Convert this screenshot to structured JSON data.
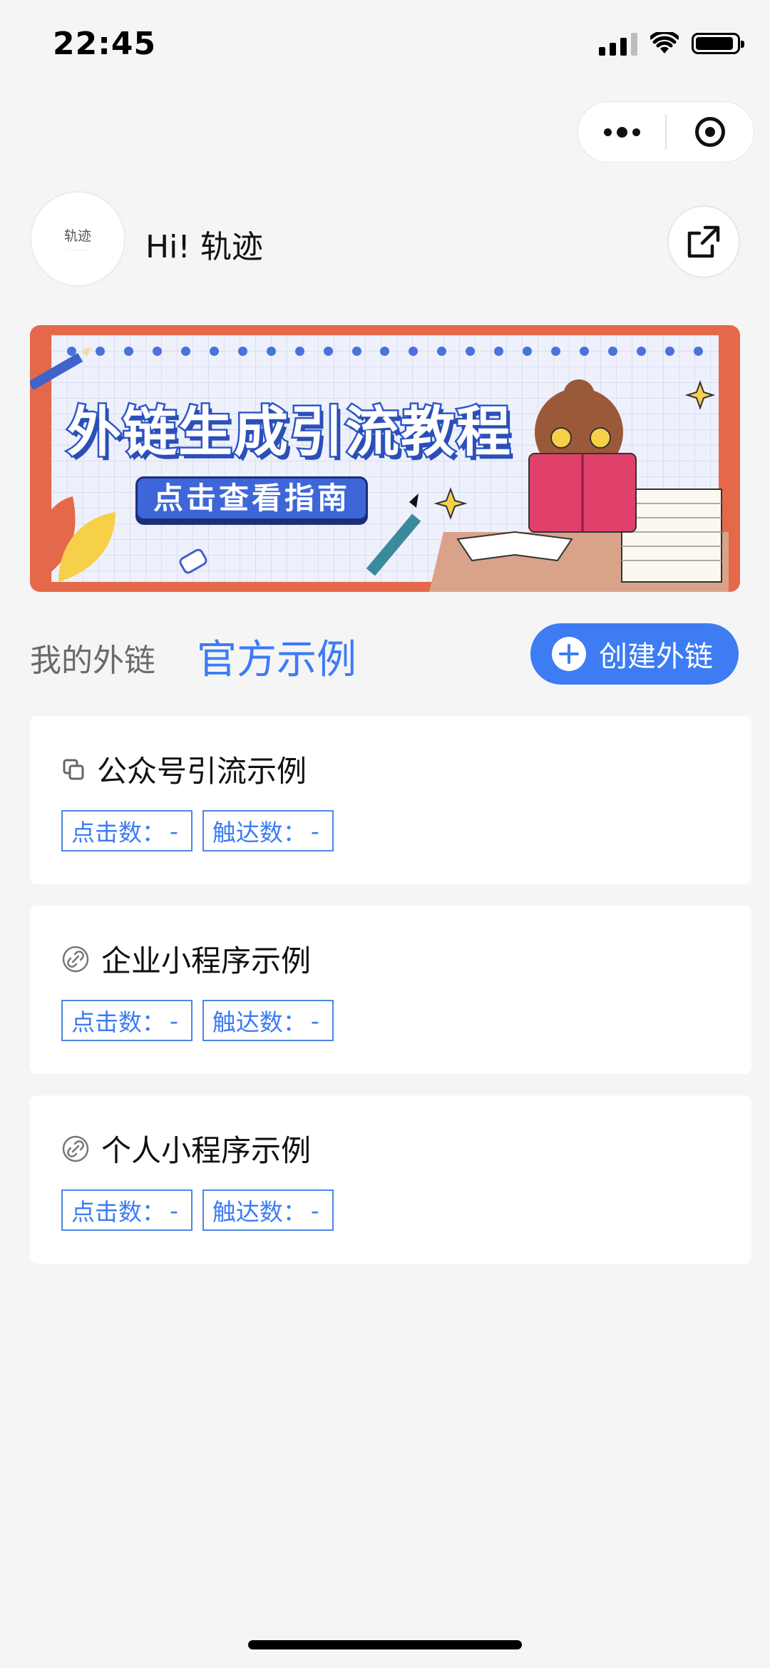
{
  "status_bar": {
    "time": "22:45"
  },
  "header": {
    "avatar_text": "轨迹",
    "greeting": "Hi! 轨迹"
  },
  "banner": {
    "title": "外链生成引流教程",
    "cta": "点击查看指南"
  },
  "tabs": {
    "mine": "我的外链",
    "official": "官方示例"
  },
  "create_button": {
    "label": "创建外链"
  },
  "cards": [
    {
      "icon": "copy-icon",
      "title": "公众号引流示例",
      "click_label": "点击数：",
      "click_value": "-",
      "reach_label": "触达数：",
      "reach_value": "-"
    },
    {
      "icon": "link-icon",
      "title": "企业小程序示例",
      "click_label": "点击数：",
      "click_value": "-",
      "reach_label": "触达数：",
      "reach_value": "-"
    },
    {
      "icon": "link-icon",
      "title": "个人小程序示例",
      "click_label": "点击数：",
      "click_value": "-",
      "reach_label": "触达数：",
      "reach_value": "-"
    }
  ],
  "colors": {
    "accent": "#3d7cf2",
    "banner_frame": "#e4694a",
    "background": "#f5f5f6"
  }
}
